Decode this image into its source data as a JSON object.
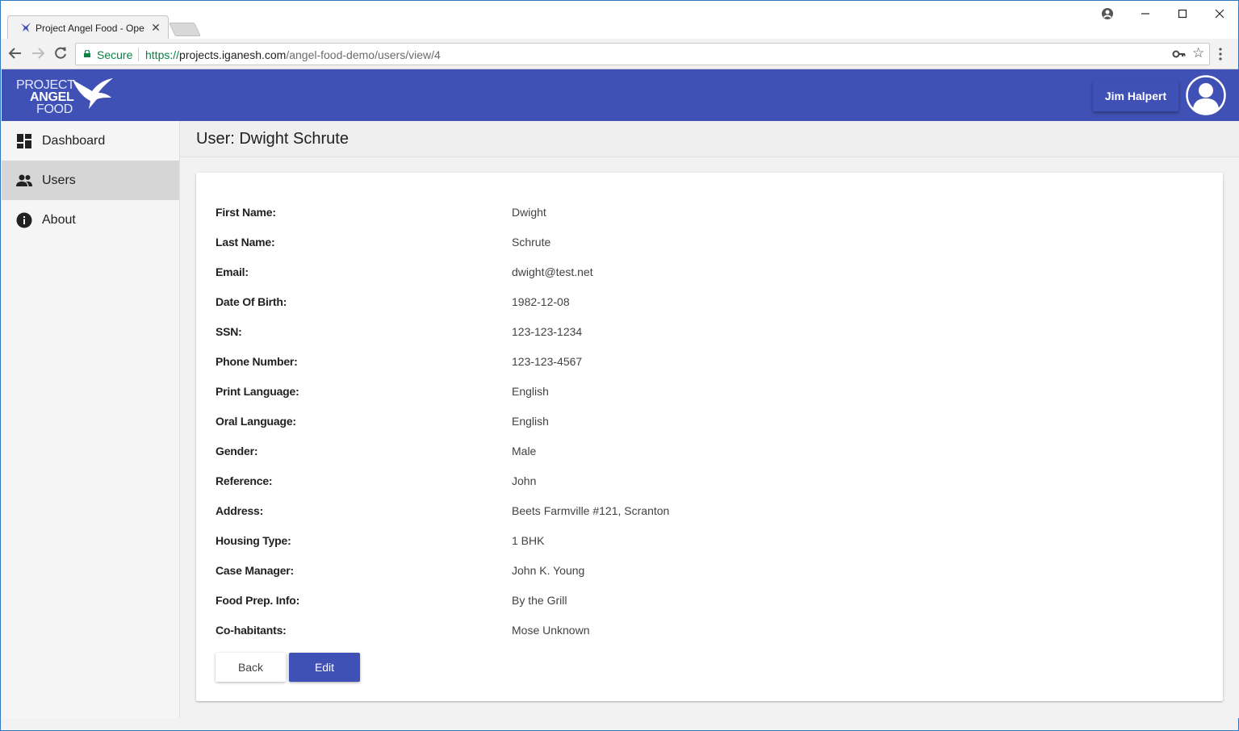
{
  "browser": {
    "tab_title": "Project Angel Food - Ope",
    "secure_label": "Secure",
    "url_scheme": "https://",
    "url_host": "projects.iganesh.com",
    "url_path": "/angel-food-demo/users/view/4"
  },
  "header": {
    "logo_line1": "PROJECT",
    "logo_line2": "ANGEL",
    "logo_line3": "FOOD",
    "user_name": "Jim Halpert",
    "brand_color": "#3f51b5"
  },
  "sidebar": {
    "items": [
      {
        "label": "Dashboard",
        "icon": "dashboard-icon",
        "active": false
      },
      {
        "label": "Users",
        "icon": "users-icon",
        "active": true
      },
      {
        "label": "About",
        "icon": "info-icon",
        "active": false
      }
    ]
  },
  "page": {
    "title": "User: Dwight Schrute"
  },
  "details": [
    {
      "label": "First Name:",
      "value": "Dwight"
    },
    {
      "label": "Last Name:",
      "value": "Schrute"
    },
    {
      "label": "Email:",
      "value": "dwight@test.net"
    },
    {
      "label": "Date Of Birth:",
      "value": "1982-12-08"
    },
    {
      "label": "SSN:",
      "value": "123-123-1234"
    },
    {
      "label": "Phone Number:",
      "value": "123-123-4567"
    },
    {
      "label": "Print Language:",
      "value": "English"
    },
    {
      "label": "Oral Language:",
      "value": "English"
    },
    {
      "label": "Gender:",
      "value": "Male"
    },
    {
      "label": "Reference:",
      "value": "John"
    },
    {
      "label": "Address:",
      "value": "Beets Farmville #121, Scranton"
    },
    {
      "label": "Housing Type:",
      "value": "1 BHK"
    },
    {
      "label": "Case Manager:",
      "value": "John K. Young"
    },
    {
      "label": "Food Prep. Info:",
      "value": "By the Grill"
    },
    {
      "label": "Co-habitants:",
      "value": "Mose Unknown"
    }
  ],
  "actions": {
    "back_label": "Back",
    "edit_label": "Edit"
  }
}
